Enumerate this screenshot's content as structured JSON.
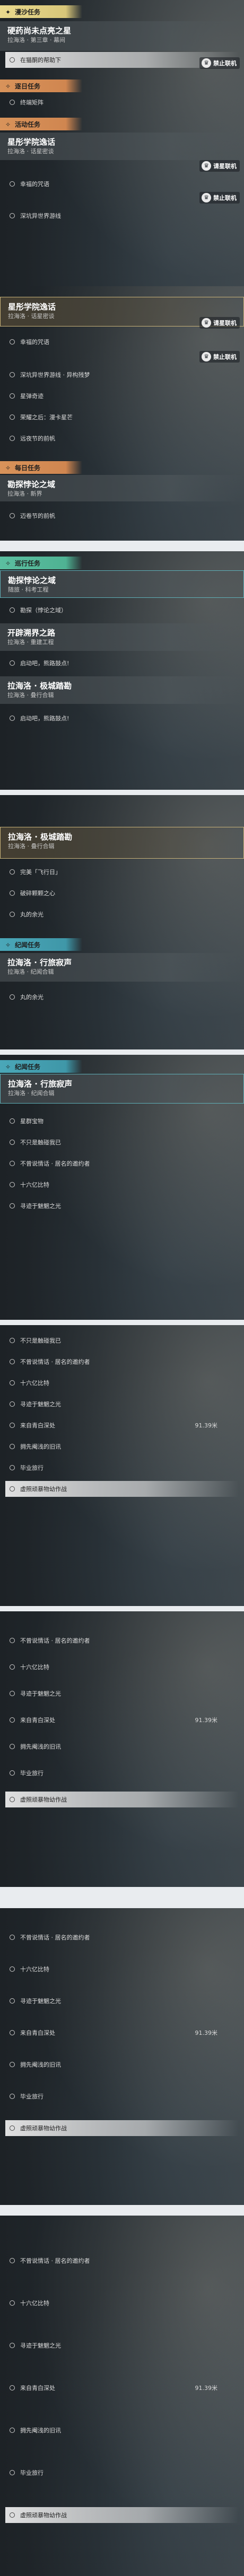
{
  "headers": {
    "flow": "漫沙任务",
    "errand": "逐日任务",
    "event": "活动任务",
    "daily": "每日任务",
    "explore": "巡行任务",
    "record": "纪闻任务"
  },
  "badges": {
    "ban_online": "禁止联机",
    "cancel_online": "请星联机"
  },
  "q1": {
    "title": "硬药尚未点亮之星",
    "sub": "拉海洛 · 第三章 · 幕间",
    "step": "在猫酮的帮助下"
  },
  "q2": {
    "step": "终端矩阵"
  },
  "q3": {
    "title": "星彤学院逸话",
    "sub": "拉海洛 · 话星密谈"
  },
  "q3_steps": [
    "幸福的咒语",
    "深坑异世界游线"
  ],
  "q4": {
    "title": "星彤学院逸话",
    "sub": "拉海洛 · 话星密谈"
  },
  "q4_steps": [
    "幸福的咒语",
    "深坑异世界游线 · 异构残梦",
    "星弹奇迹",
    "荣耀之后：漫卡星芒",
    "远夜节的前帆"
  ],
  "q5": {
    "title": "勘探悖论之域",
    "sub": "拉海洛 · 新界"
  },
  "q5_steps": [
    "迈卷节的前帆"
  ],
  "q6": {
    "title": "勘探悖论之域",
    "sub": "随旅 · 科考工程"
  },
  "q6_steps": [
    "勘探（悖论之域）"
  ],
  "q7": {
    "title": "开辟溯界之路",
    "sub": "拉海洛 · 重建工程"
  },
  "q7_steps": [
    "启动吧，熊路鼓点!"
  ],
  "q8": {
    "title": "拉海洛 · 极城踏勘",
    "sub": "拉海洛 · 叠行合辑"
  },
  "q8_steps": [
    "启动吧，熊路鼓点!"
  ],
  "q9": {
    "title": "拉海洛 · 极城踏勘",
    "sub": "拉海洛 · 叠行合辑"
  },
  "q9_steps": [
    "完美「飞行日」",
    "破碎颗颗之心",
    "丸的余光"
  ],
  "q10": {
    "title": "拉海洛 · 行旅寂声",
    "sub": "拉海洛 · 纪闻合辑"
  },
  "q10_steps": [
    "丸的余光"
  ],
  "q11": {
    "title": "拉海洛 · 行旅寂声",
    "sub": "拉海洛 · 纪闻合辑"
  },
  "q11_steps": [
    "星群宝物",
    "不只是触碰我已",
    "不曾说情话 · 居名的邀约者",
    "十六亿比特",
    "寻迹于魅魍之光"
  ],
  "block2_steps": [
    "不只是触碰我已",
    "不曾说情话 · 居名的邀约者",
    "十六亿比特",
    "寻迹于魅魍之光",
    "来自青白深处",
    "拥先阉浅的旧讯",
    "毕业旅行",
    "虚照顽暴物幼作战"
  ],
  "block3_steps": [
    "不曾说情话 · 居名的邀约者",
    "十六亿比特",
    "寻迹于魅魍之光",
    "来自青白深处",
    "拥先阉浅的旧讯",
    "毕业旅行",
    "虚照顽暴物幼作战"
  ],
  "block4_steps": [
    "不曾说情话 · 居名的邀约者",
    "十六亿比特",
    "寻迹于魅魍之光",
    "来自青白深处",
    "拥先阉浅的旧讯",
    "毕业旅行",
    "虚照顽暴物幼作战"
  ],
  "block5_steps": [
    "不曾说情话 · 居名的邀约者",
    "十六亿比特",
    "寻迹于魅魍之光",
    "来自青白深处",
    "拥先阉浅的旧讯",
    "毕业旅行",
    "虚照顽暴物幼作战"
  ],
  "distance": "91.39米"
}
